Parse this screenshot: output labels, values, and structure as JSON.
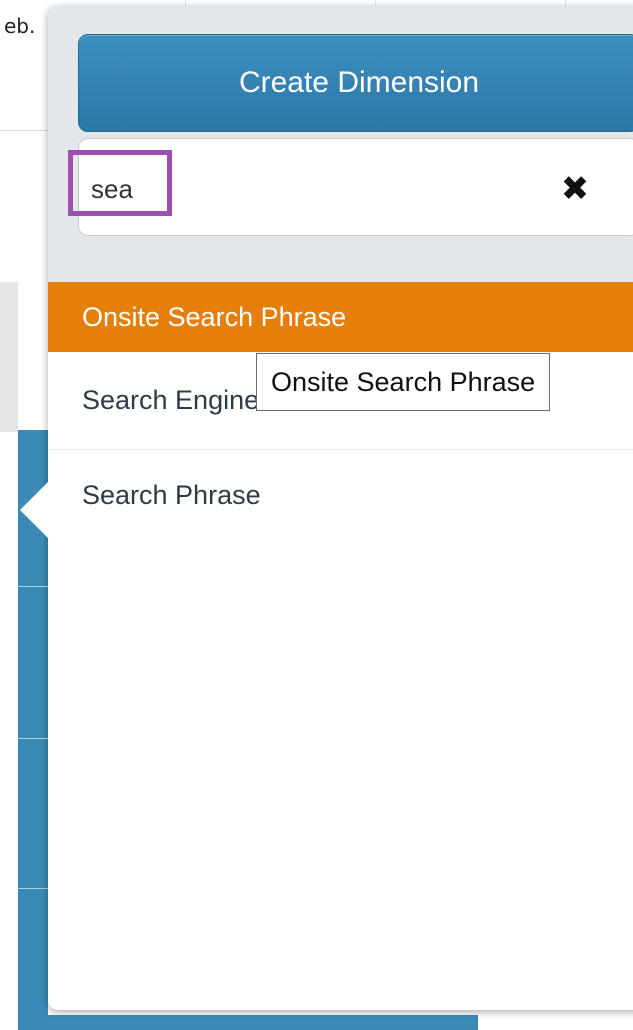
{
  "background": {
    "breadcrumb_fragment": "eb."
  },
  "popover": {
    "create_button_label": "Create Dimension",
    "search": {
      "value": "sea",
      "clear_icon": "close-icon"
    },
    "results": [
      {
        "label": "Onsite Search Phrase",
        "selected": true
      },
      {
        "label": "Search Engine",
        "selected": false
      },
      {
        "label": "Search Phrase",
        "selected": false
      }
    ],
    "tooltip_text": "Onsite Search Phrase"
  },
  "colors": {
    "button_blue": "#2f80b0",
    "selected_orange": "#e67e0a",
    "highlight_purple": "#9c4fb0",
    "header_grey": "#e3e7eb"
  }
}
